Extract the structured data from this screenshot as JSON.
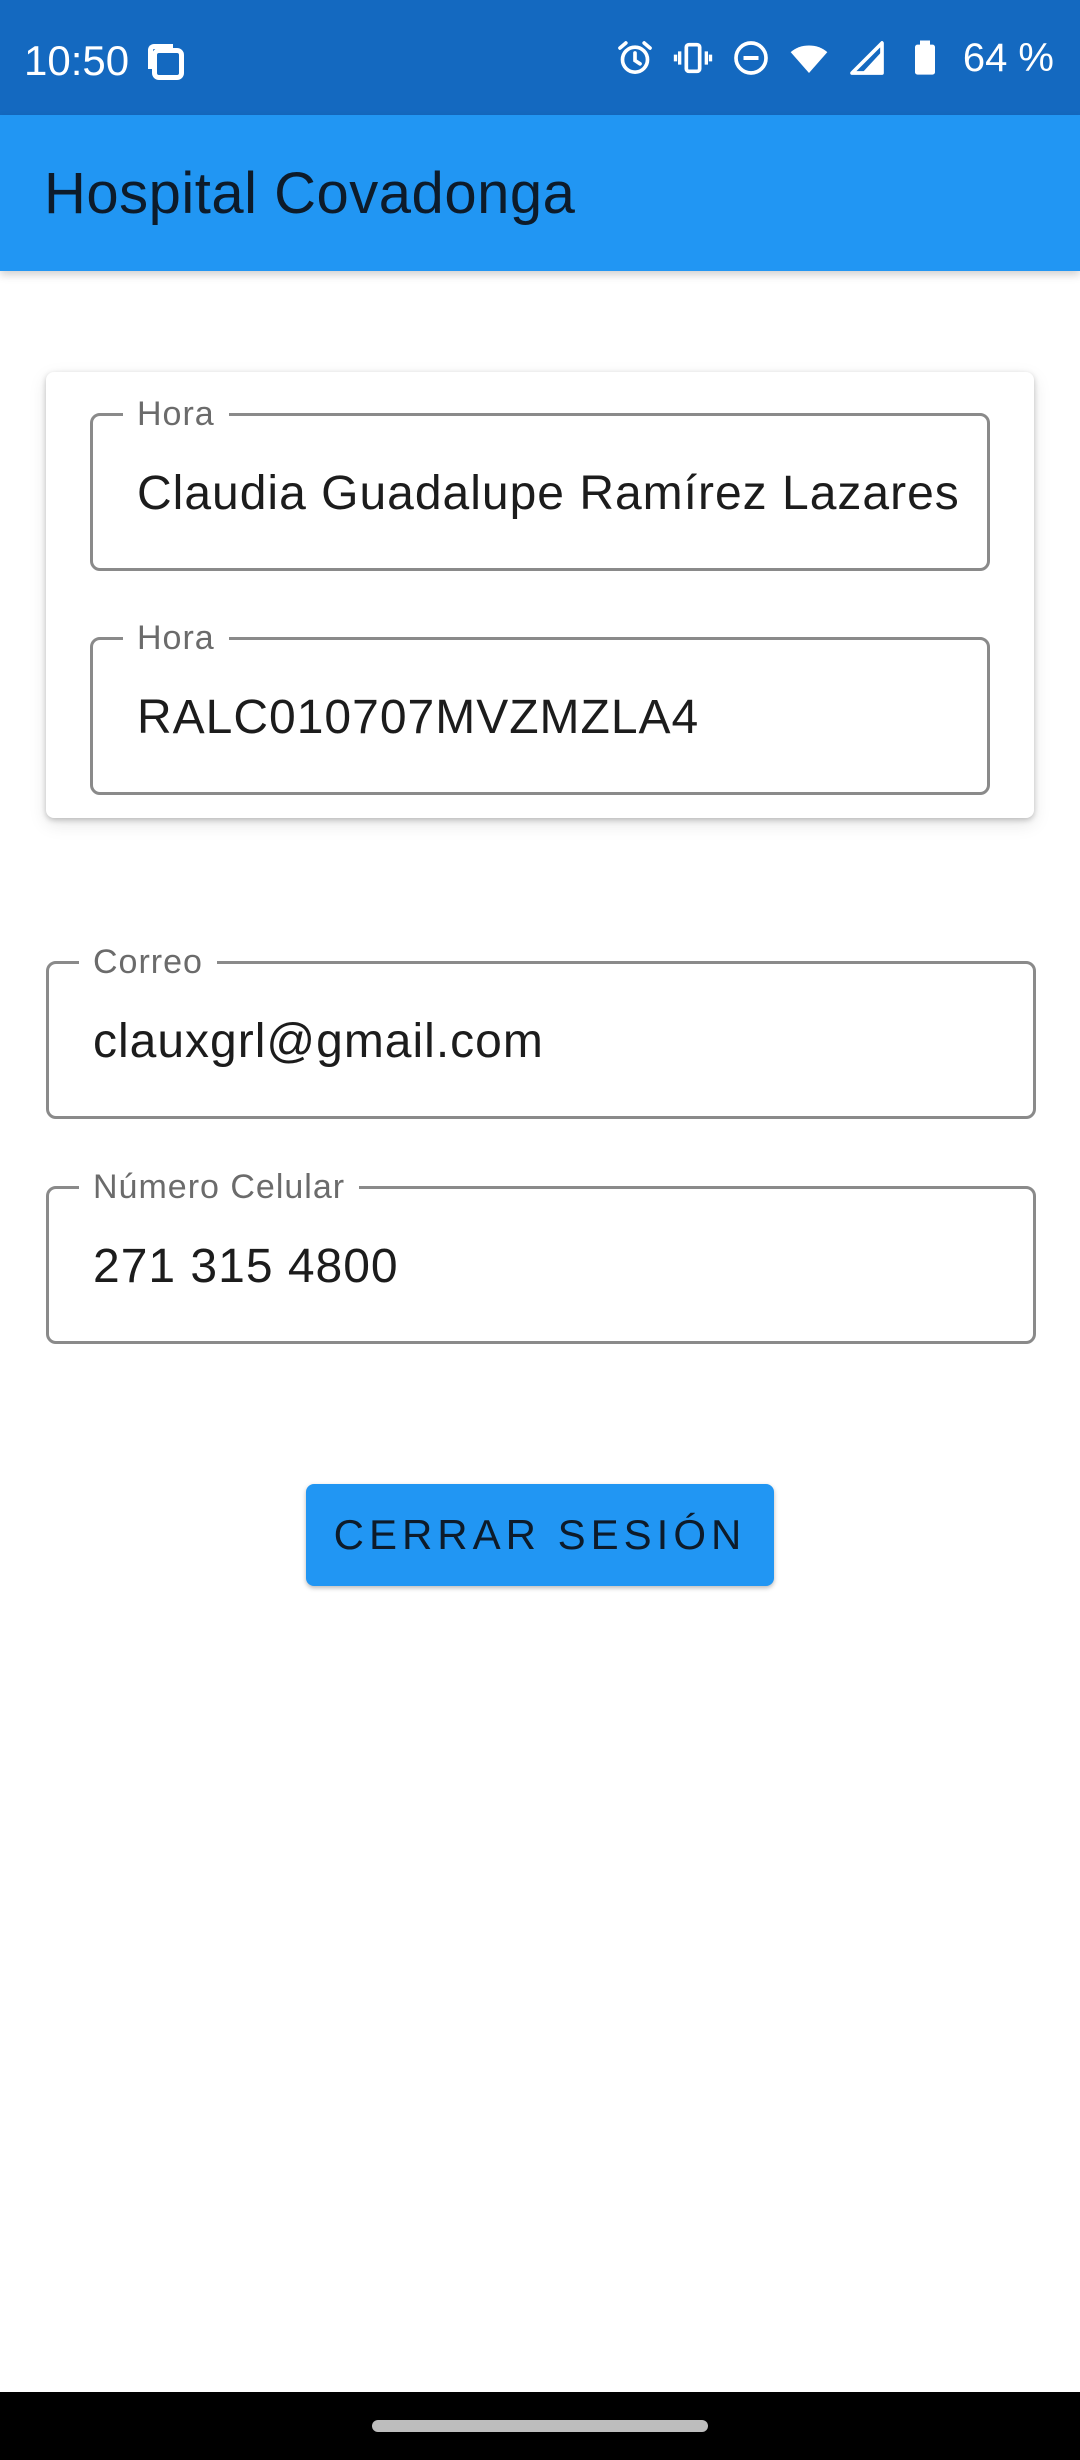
{
  "status_bar": {
    "time": "10:50",
    "battery": "64 %",
    "icons": [
      "notification-square-icon",
      "alarm-icon",
      "vibrate-icon",
      "do-not-disturb-icon",
      "wifi-icon",
      "signal-icon",
      "battery-icon"
    ]
  },
  "app_bar": {
    "title": "Hospital Covadonga",
    "color": "#2196f3"
  },
  "profile_card": {
    "fields": [
      {
        "label": "Hora",
        "value": "Claudia Guadalupe Ramírez Lazares"
      },
      {
        "label": "Hora",
        "value": "RALC010707MVZMZLA4"
      }
    ]
  },
  "contact": {
    "email": {
      "label": "Correo",
      "value": "clauxgrl@gmail.com"
    },
    "phone": {
      "label": "Número Celular",
      "value": "271 315 4800"
    }
  },
  "actions": {
    "logout_label": "CERRAR SESIÓN"
  },
  "colors": {
    "status_bar": "#1469c0",
    "accent": "#2196f3",
    "outline": "#8a8a8a"
  }
}
